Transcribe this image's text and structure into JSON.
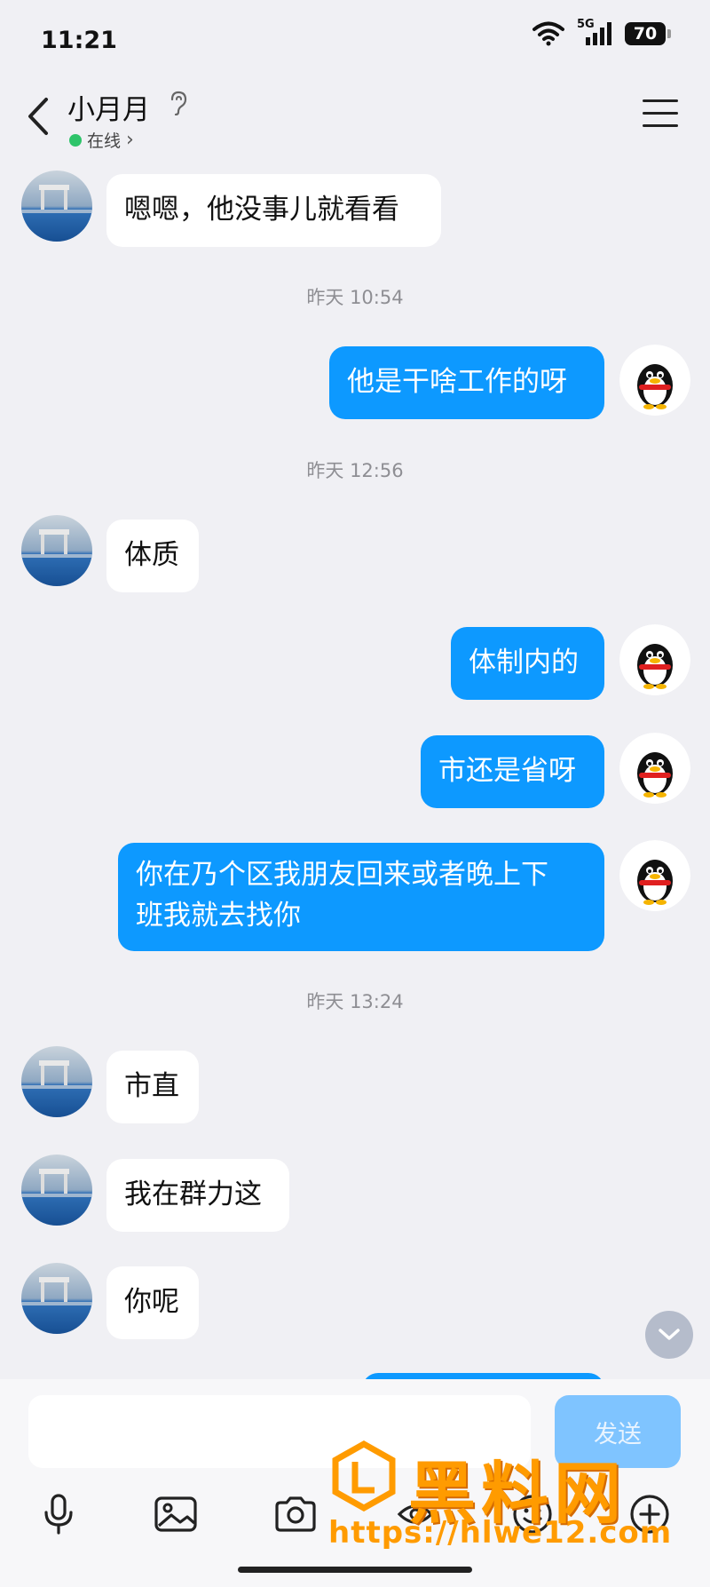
{
  "status": {
    "time": "11:21",
    "battery": "70",
    "network": "5G"
  },
  "header": {
    "contact_name": "小月月",
    "status": "在线",
    "status_chevron": "›"
  },
  "messages": [
    {
      "side": "in",
      "text": "嗯嗯，他没事儿就看看"
    },
    {
      "type": "timestamp",
      "text": "昨天 10:54"
    },
    {
      "side": "out",
      "text": "他是干啥工作的呀"
    },
    {
      "type": "timestamp",
      "text": "昨天 12:56"
    },
    {
      "side": "in",
      "text": "体质"
    },
    {
      "side": "out",
      "text": "体制内的"
    },
    {
      "side": "out",
      "text": "市还是省呀"
    },
    {
      "side": "out",
      "text_line1": "你在乃个区我朋友回来或者晚上下",
      "text_line2": "班我就去找你"
    },
    {
      "type": "timestamp",
      "text": "昨天 13:24"
    },
    {
      "side": "in",
      "text": "市直"
    },
    {
      "side": "in",
      "text": "我在群力这"
    },
    {
      "side": "in",
      "text": "你呢"
    }
  ],
  "composer": {
    "input_value": "",
    "send_label": "发送"
  },
  "watermark": {
    "title": "黑料网",
    "url": "https://hlwe12.com"
  },
  "colors": {
    "outgoing_bubble": "#0d99ff",
    "incoming_bubble": "#ffffff",
    "background": "#f0f0f4",
    "online_dot": "#2ec46a"
  }
}
